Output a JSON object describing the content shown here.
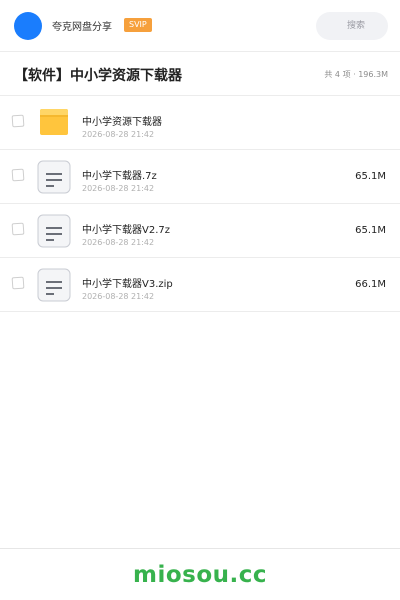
{
  "header": {
    "user_name": "夸克网盘分享",
    "badge": "SVIP",
    "search_label": "搜索",
    "avatar_color": "#1a7dfd",
    "badge_color": "#f6a03c"
  },
  "folder": {
    "title": "【软件】中小学资源下载器",
    "summary": "共 4 项 · 196.3M"
  },
  "files": [
    {
      "name": "中小学资源下载器",
      "date": "2026-08-28 21:42",
      "size": "",
      "icon": "folder-icon"
    },
    {
      "name": "中小学下载器.7z",
      "date": "2026-08-28 21:42",
      "size": "65.1M",
      "icon": "archive-file-icon"
    },
    {
      "name": "中小学下载器V2.7z",
      "date": "2026-08-28 21:42",
      "size": "65.1M",
      "icon": "archive-file-icon"
    },
    {
      "name": "中小学下载器V3.zip",
      "date": "2026-08-28 21:42",
      "size": "66.1M",
      "icon": "archive-file-icon"
    }
  ],
  "footer": {
    "watermark": "miosou.cc",
    "watermark_color": "#37b24d"
  }
}
